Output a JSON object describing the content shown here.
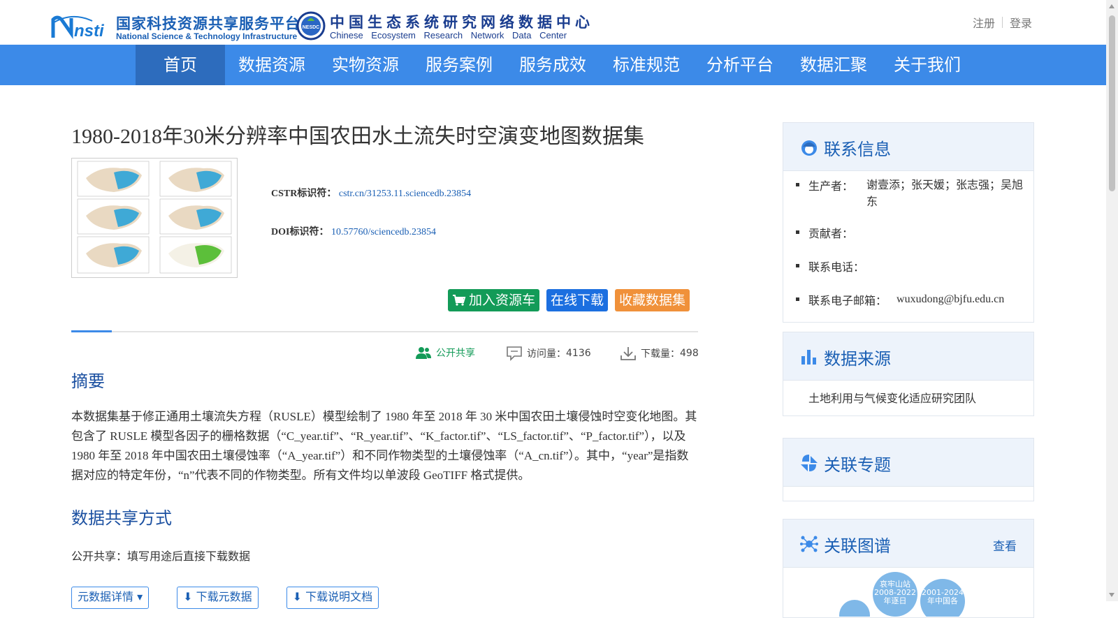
{
  "header": {
    "logo1_cn": "国家科技资源共享服务平台",
    "logo1_en": "National Science & Technology Infrastructure",
    "logo1_mark": "nsti",
    "logo2_seal": "NESDC",
    "logo2_cn": "中国生态系统研究网络数据中心",
    "logo2_en": "Chinese Ecosystem Research Network Data Center",
    "register": "注册",
    "login": "登录"
  },
  "nav": {
    "items": [
      "首页",
      "数据资源",
      "实物资源",
      "服务案例",
      "服务成效",
      "标准规范",
      "分析平台",
      "数据汇聚",
      "关于我们"
    ],
    "active_index": 0
  },
  "dataset": {
    "title": "1980-2018年30米分辨率中国农田水土流失时空演变地图数据集",
    "cstr_label": "CSTR标识符：",
    "cstr_value": "cstr.cn/31253.11.sciencedb.23854",
    "doi_label": "DOI标识符：",
    "doi_value": "10.57760/sciencedb.23854",
    "btn_cart": "加入资源车",
    "btn_download": "在线下载",
    "btn_collect": "收藏数据集",
    "share_label": "公开共享",
    "visits_label": "访问量：",
    "visits": "4136",
    "downloads_label": "下载量：",
    "downloads": "498"
  },
  "abstract": {
    "heading": "摘要",
    "text": "本数据集基于修正通用土壤流失方程（RUSLE）模型绘制了 1980 年至 2018 年 30 米中国农田土壤侵蚀时空变化地图。其包含了 RUSLE 模型各因子的栅格数据（“C_year.tif”、“R_year.tif”、“K_factor.tif”、“LS_factor.tif”、“P_factor.tif”），以及 1980 年至 2018 年中国农田土壤侵蚀率（“A_year.tif”）和不同作物类型的土壤侵蚀率（“A_cn.tif”）。其中，“year”是指数据对应的特定年份，“n”代表不同的作物类型。所有文件均以单波段 GeoTIFF 格式提供。"
  },
  "sharing": {
    "heading": "数据共享方式",
    "text": "公开共享：填写用途后直接下载数据",
    "btn_meta": "元数据详情",
    "btn_download_meta": "下载元数据",
    "btn_download_doc": "下载说明文档"
  },
  "sidebar": {
    "contact": {
      "title": "联系信息",
      "items": [
        {
          "key": "生产者：",
          "value": "谢壹添；张天媛；张志强；吴旭东"
        },
        {
          "key": "贡献者：",
          "value": ""
        },
        {
          "key": "联系电话：",
          "value": ""
        },
        {
          "key": "联系电子邮箱：",
          "value": "wuxudong@bjfu.edu.cn"
        }
      ]
    },
    "source": {
      "title": "数据来源",
      "text": "土地利用与气候变化适应研究团队"
    },
    "topics": {
      "title": "关联专题"
    },
    "graph": {
      "title": "关联图谱",
      "more": "查看",
      "node1": "哀牢山站2008-2022年逐日",
      "node2": "2001-2024年中国各"
    }
  },
  "colors": {
    "nav": "#3c8ae8",
    "nav_active": "#2d6cbd",
    "green": "#139b58",
    "blue": "#1c6fe0",
    "orange": "#f0913a",
    "heading": "#1a4fa0"
  }
}
